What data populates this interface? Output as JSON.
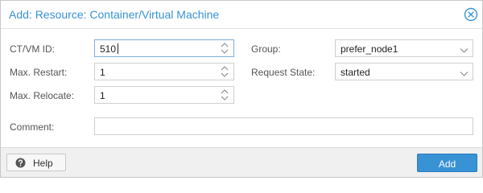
{
  "dialog": {
    "title": "Add: Resource: Container/Virtual Machine",
    "close_icon": "circle-x-icon"
  },
  "form": {
    "vmid": {
      "label": "CT/VM ID:",
      "value": "510"
    },
    "max_restart": {
      "label": "Max. Restart:",
      "value": "1"
    },
    "max_relocate": {
      "label": "Max. Relocate:",
      "value": "1"
    },
    "group": {
      "label": "Group:",
      "value": "prefer_node1"
    },
    "request_state": {
      "label": "Request State:",
      "value": "started"
    },
    "comment": {
      "label": "Comment:",
      "value": ""
    }
  },
  "footer": {
    "help_label": "Help",
    "help_icon": "question-circle-icon",
    "add_label": "Add"
  },
  "colors": {
    "accent": "#3892d4",
    "footer_bg": "#f0f0f0"
  }
}
